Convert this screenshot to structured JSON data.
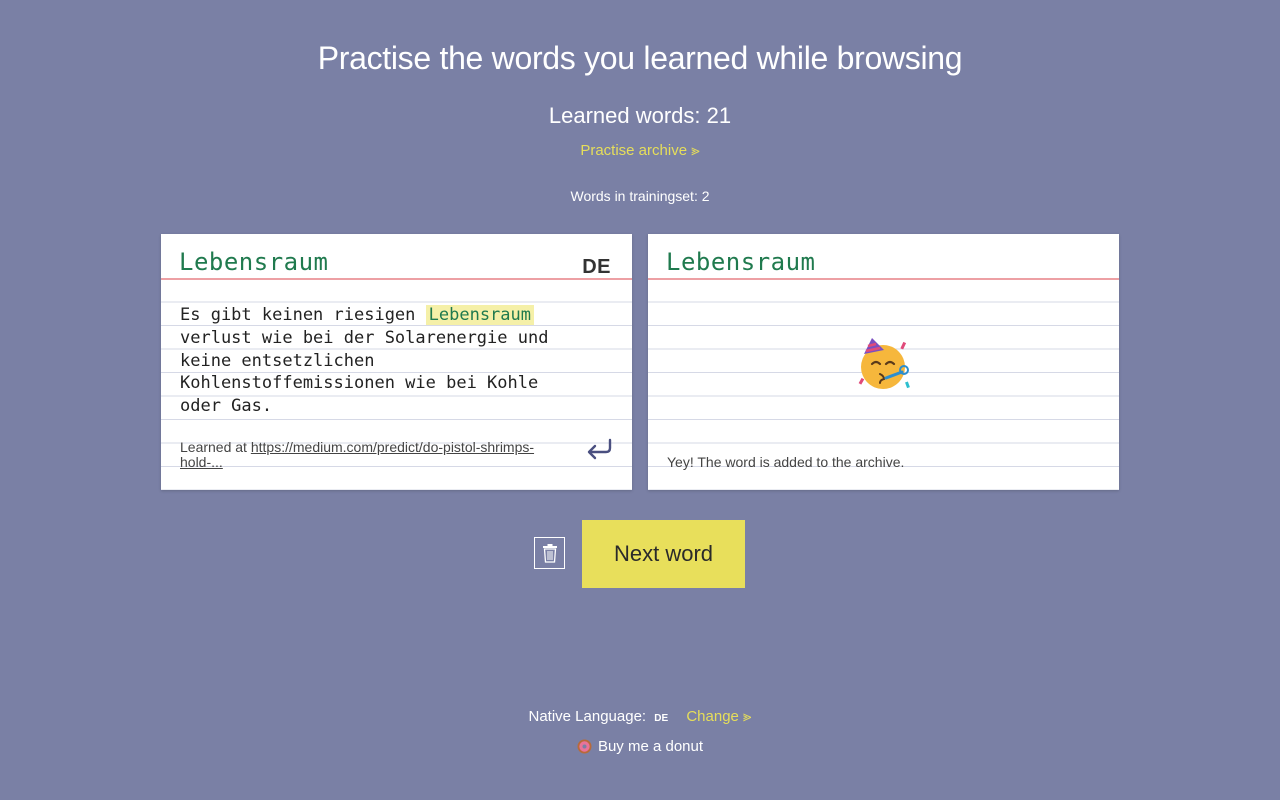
{
  "header": {
    "title": "Practise the words you learned while browsing",
    "learned_words": "Learned words: 21",
    "archive_link": "Practise archive ⪢",
    "trainingset": "Words in trainingset: 2"
  },
  "left_card": {
    "word": "Lebensraum",
    "language": "DE",
    "sentence_before": "Es gibt keinen riesigen ",
    "sentence_highlight": "Lebensraum",
    "sentence_after": " verlust wie bei der Solarenergie und keine entsetzlichen Kohlenstoffemissionen wie bei Kohle oder Gas.",
    "learned_at_label": "Learned at ",
    "learned_at_url": "https://medium.com/predict/do-pistol-shrimps-hold-...",
    "icons": {
      "return": "return-arrow-icon"
    }
  },
  "right_card": {
    "word": "Lebensraum",
    "message": "Yey! The word is added to the archive.",
    "icons": {
      "emoji": "party-face-icon"
    }
  },
  "actions": {
    "next_word": "Next word",
    "icons": {
      "delete": "trash-icon"
    }
  },
  "footer": {
    "native_language_label": "Native Language:",
    "native_language_value": "DE",
    "change_link": "Change ⪢",
    "donut_link": "Buy me a donut",
    "icons": {
      "donut": "donut-icon"
    }
  },
  "colors": {
    "background": "#7a80a5",
    "accent_yellow": "#e8df5b",
    "word_green": "#207a4e",
    "highlight": "#f5f0a8",
    "card_red_line": "#eda0a4"
  }
}
